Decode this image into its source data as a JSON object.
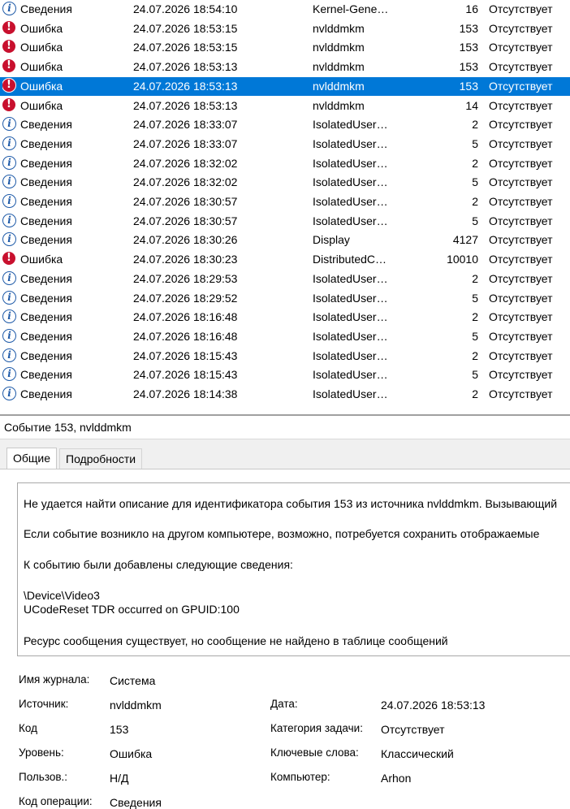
{
  "icons": {
    "info": "i",
    "error": "!"
  },
  "colors": {
    "selection": "#0078d7",
    "error_icon": "#c8102e",
    "info_icon": "#1e5aa8"
  },
  "events": [
    {
      "type": "info",
      "level": "Сведения",
      "date": "24.07.2026 18:54:10",
      "source": "Kernel-Gene…",
      "code": "16",
      "category": "Отсутствует"
    },
    {
      "type": "error",
      "level": "Ошибка",
      "date": "24.07.2026 18:53:15",
      "source": "nvlddmkm",
      "code": "153",
      "category": "Отсутствует"
    },
    {
      "type": "error",
      "level": "Ошибка",
      "date": "24.07.2026 18:53:15",
      "source": "nvlddmkm",
      "code": "153",
      "category": "Отсутствует"
    },
    {
      "type": "error",
      "level": "Ошибка",
      "date": "24.07.2026 18:53:13",
      "source": "nvlddmkm",
      "code": "153",
      "category": "Отсутствует"
    },
    {
      "type": "error",
      "level": "Ошибка",
      "date": "24.07.2026 18:53:13",
      "source": "nvlddmkm",
      "code": "153",
      "category": "Отсутствует",
      "selected": true
    },
    {
      "type": "error",
      "level": "Ошибка",
      "date": "24.07.2026 18:53:13",
      "source": "nvlddmkm",
      "code": "14",
      "category": "Отсутствует"
    },
    {
      "type": "info",
      "level": "Сведения",
      "date": "24.07.2026 18:33:07",
      "source": "IsolatedUser…",
      "code": "2",
      "category": "Отсутствует"
    },
    {
      "type": "info",
      "level": "Сведения",
      "date": "24.07.2026 18:33:07",
      "source": "IsolatedUser…",
      "code": "5",
      "category": "Отсутствует"
    },
    {
      "type": "info",
      "level": "Сведения",
      "date": "24.07.2026 18:32:02",
      "source": "IsolatedUser…",
      "code": "2",
      "category": "Отсутствует"
    },
    {
      "type": "info",
      "level": "Сведения",
      "date": "24.07.2026 18:32:02",
      "source": "IsolatedUser…",
      "code": "5",
      "category": "Отсутствует"
    },
    {
      "type": "info",
      "level": "Сведения",
      "date": "24.07.2026 18:30:57",
      "source": "IsolatedUser…",
      "code": "2",
      "category": "Отсутствует"
    },
    {
      "type": "info",
      "level": "Сведения",
      "date": "24.07.2026 18:30:57",
      "source": "IsolatedUser…",
      "code": "5",
      "category": "Отсутствует"
    },
    {
      "type": "info",
      "level": "Сведения",
      "date": "24.07.2026 18:30:26",
      "source": "Display",
      "code": "4127",
      "category": "Отсутствует"
    },
    {
      "type": "error",
      "level": "Ошибка",
      "date": "24.07.2026 18:30:23",
      "source": "DistributedC…",
      "code": "10010",
      "category": "Отсутствует"
    },
    {
      "type": "info",
      "level": "Сведения",
      "date": "24.07.2026 18:29:53",
      "source": "IsolatedUser…",
      "code": "2",
      "category": "Отсутствует"
    },
    {
      "type": "info",
      "level": "Сведения",
      "date": "24.07.2026 18:29:52",
      "source": "IsolatedUser…",
      "code": "5",
      "category": "Отсутствует"
    },
    {
      "type": "info",
      "level": "Сведения",
      "date": "24.07.2026 18:16:48",
      "source": "IsolatedUser…",
      "code": "2",
      "category": "Отсутствует"
    },
    {
      "type": "info",
      "level": "Сведения",
      "date": "24.07.2026 18:16:48",
      "source": "IsolatedUser…",
      "code": "5",
      "category": "Отсутствует"
    },
    {
      "type": "info",
      "level": "Сведения",
      "date": "24.07.2026 18:15:43",
      "source": "IsolatedUser…",
      "code": "2",
      "category": "Отсутствует"
    },
    {
      "type": "info",
      "level": "Сведения",
      "date": "24.07.2026 18:15:43",
      "source": "IsolatedUser…",
      "code": "5",
      "category": "Отсутствует"
    },
    {
      "type": "info",
      "level": "Сведения",
      "date": "24.07.2026 18:14:38",
      "source": "IsolatedUser…",
      "code": "2",
      "category": "Отсутствует"
    }
  ],
  "details": {
    "title": "Событие 153, nvlddmkm",
    "tabs": [
      {
        "label": "Общие"
      },
      {
        "label": "Подробности"
      }
    ],
    "description": [
      "Не удается найти описание для идентификатора события 153 из источника nvlddmkm. Вызывающий",
      "Если событие возникло на другом компьютере, возможно, потребуется сохранить отображаемые",
      "К событию были добавлены следующие сведения:",
      "\\Device\\Video3",
      "UCodeReset TDR occurred on GPUID:100",
      "Ресурс сообщения существует, но сообщение не найдено в таблице сообщений"
    ],
    "properties": {
      "log_name": {
        "label": "Имя журнала:",
        "value": "Система"
      },
      "source": {
        "label": "Источник:",
        "value": "nvlddmkm"
      },
      "date": {
        "label": "Дата:",
        "value": "24.07.2026 18:53:13"
      },
      "code": {
        "label": "Код",
        "value": "153"
      },
      "task_category": {
        "label": "Категория задачи:",
        "value": "Отсутствует"
      },
      "level": {
        "label": "Уровень:",
        "value": "Ошибка"
      },
      "keywords": {
        "label": "Ключевые слова:",
        "value": "Классический"
      },
      "user": {
        "label": "Пользов.:",
        "value": "Н/Д"
      },
      "computer": {
        "label": "Компьютер:",
        "value": "Arhon"
      },
      "opcode": {
        "label": "Код операции:",
        "value": "Сведения"
      }
    }
  }
}
